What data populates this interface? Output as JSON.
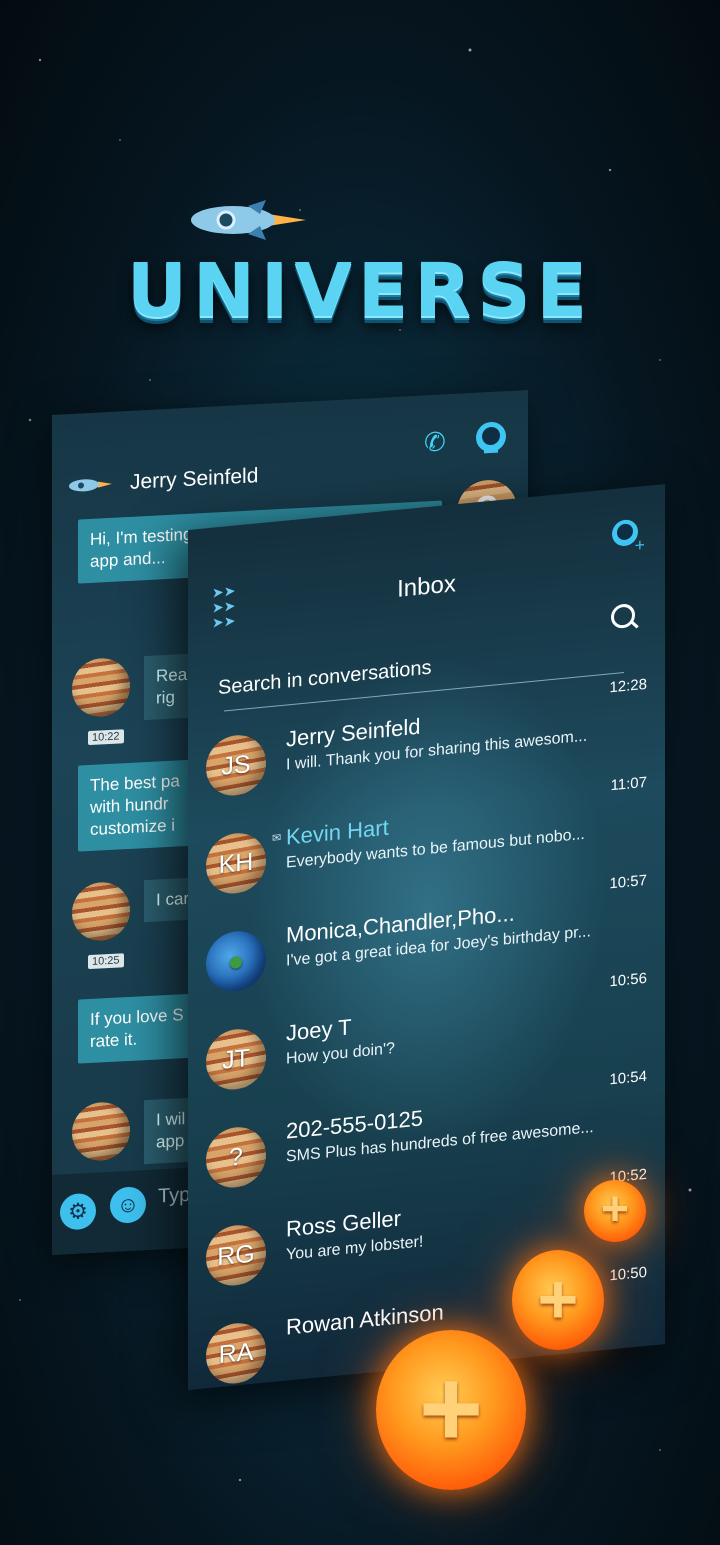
{
  "app": {
    "title": "UNIVERSE"
  },
  "chat": {
    "contact_name": "Jerry Seinfeld",
    "messages": [
      {
        "dir": "out",
        "text": "Hi, I'm testing you using the new SMS Plus app and..."
      },
      {
        "dir": "in",
        "text": "Real it rig"
      },
      {
        "dir": "out",
        "text": "The best pa with hundr customize i"
      },
      {
        "dir": "in",
        "text": "I car"
      },
      {
        "dir": "out",
        "text": "If you love S rate it."
      },
      {
        "dir": "in",
        "text": "I wil app"
      }
    ],
    "timestamps": [
      "10:22",
      "10:25"
    ],
    "input_placeholder": "Typ"
  },
  "inbox": {
    "title": "Inbox",
    "search_placeholder": "Search in conversations",
    "conversations": [
      {
        "initials": "JS",
        "name": "Jerry Seinfeld",
        "preview": "I will. Thank you for sharing this awesom...",
        "time": "12:28",
        "unread": false
      },
      {
        "initials": "KH",
        "name": "Kevin Hart",
        "preview": "Everybody wants to be famous but nobo...",
        "time": "11:07",
        "unread": true
      },
      {
        "initials": "",
        "name": "Monica,Chandler,Pho...",
        "preview": "I've got a great idea for Joey's birthday pr...",
        "time": "10:57",
        "unread": false
      },
      {
        "initials": "JT",
        "name": "Joey T",
        "preview": "How you doin'?",
        "time": "10:56",
        "unread": false
      },
      {
        "initials": "?",
        "name": "202-555-0125",
        "preview": "SMS Plus has hundreds of free awesome...",
        "time": "10:54",
        "unread": false
      },
      {
        "initials": "RG",
        "name": "Ross Geller",
        "preview": "You are my lobster!",
        "time": "10:52",
        "unread": false
      },
      {
        "initials": "RA",
        "name": "Rowan Atkinson",
        "preview": "",
        "time": "10:50",
        "unread": false
      }
    ]
  },
  "fab": {
    "symbol": "+"
  },
  "colors": {
    "accent": "#3fd3f5",
    "logo": "#5ad4f2",
    "fab": "#ff8a1e"
  }
}
